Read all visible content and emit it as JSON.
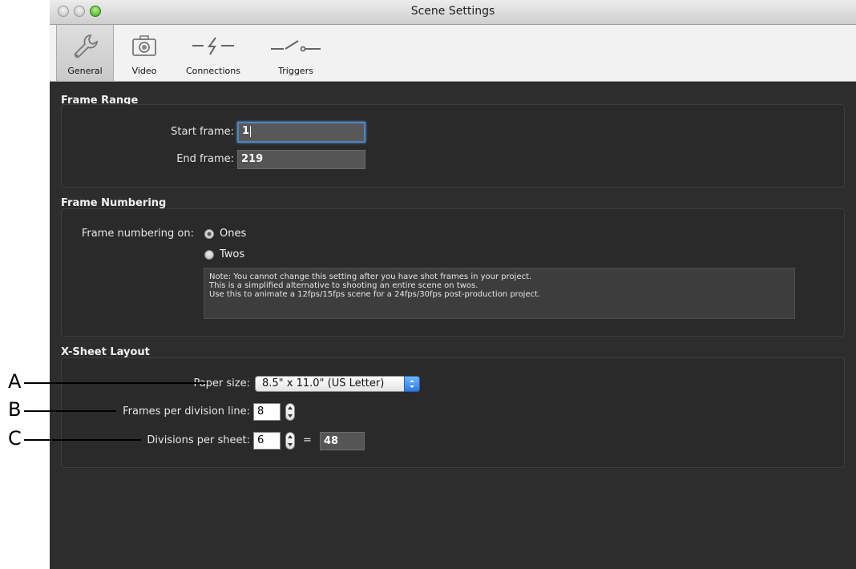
{
  "window": {
    "title": "Scene Settings"
  },
  "toolbar": {
    "tabs": [
      {
        "label": "General",
        "icon": "wrench-icon"
      },
      {
        "label": "Video",
        "icon": "camera-icon"
      },
      {
        "label": "Connections",
        "icon": "lightning-connector-icon"
      },
      {
        "label": "Triggers",
        "icon": "switch-icon"
      }
    ],
    "active_tab": "General"
  },
  "frame_range": {
    "title": "Frame Range",
    "start_label": "Start frame:",
    "start_value": "1",
    "end_label": "End frame:",
    "end_value": "219"
  },
  "frame_numbering": {
    "title": "Frame Numbering",
    "label": "Frame numbering on:",
    "options": [
      "Ones",
      "Twos"
    ],
    "selected": "Ones",
    "note": [
      "Note: You cannot change this setting after you have shot frames in your project.",
      "This is a simplified alternative to shooting an entire scene on twos.",
      "Use this to animate a 12fps/15fps scene for a 24fps/30fps post-production project."
    ]
  },
  "xsheet": {
    "title": "X-Sheet Layout",
    "paper_label": "Paper size:",
    "paper_value": "8.5\" x 11.0\" (US Letter)",
    "frames_label": "Frames per division line:",
    "frames_value": "8",
    "divisions_label": "Divisions per sheet:",
    "divisions_value": "6",
    "equals": "=",
    "total_value": "48"
  },
  "callouts": [
    "A",
    "B",
    "C"
  ],
  "colors": {
    "background": "#2d2d2d",
    "focus": "#4a86c6",
    "zoom_button": "#3aa51c"
  }
}
